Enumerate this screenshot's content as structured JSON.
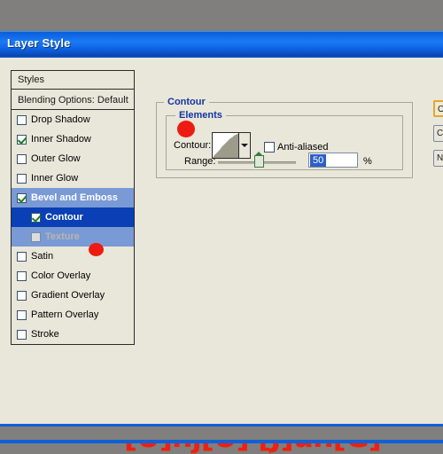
{
  "window": {
    "title": "Layer Style"
  },
  "styles_panel": {
    "header": "Styles",
    "blending_options": "Blending Options: Default",
    "effects": [
      {
        "label": "Drop Shadow",
        "checked": false,
        "sub": false,
        "state": "normal"
      },
      {
        "label": "Inner Shadow",
        "checked": true,
        "sub": false,
        "state": "normal"
      },
      {
        "label": "Outer Glow",
        "checked": false,
        "sub": false,
        "state": "normal"
      },
      {
        "label": "Inner Glow",
        "checked": false,
        "sub": false,
        "state": "normal"
      },
      {
        "label": "Bevel and Emboss",
        "checked": true,
        "sub": false,
        "state": "selected-light"
      },
      {
        "label": "Contour",
        "checked": true,
        "sub": true,
        "state": "selected-dark"
      },
      {
        "label": "Texture",
        "checked": false,
        "sub": true,
        "state": "disabled"
      },
      {
        "label": "Satin",
        "checked": false,
        "sub": false,
        "state": "normal"
      },
      {
        "label": "Color Overlay",
        "checked": false,
        "sub": false,
        "state": "normal"
      },
      {
        "label": "Gradient Overlay",
        "checked": false,
        "sub": false,
        "state": "normal"
      },
      {
        "label": "Pattern Overlay",
        "checked": false,
        "sub": false,
        "state": "normal"
      },
      {
        "label": "Stroke",
        "checked": false,
        "sub": false,
        "state": "normal"
      }
    ]
  },
  "contour_panel": {
    "group_legend": "Contour",
    "elements_legend": "Elements",
    "contour_label": "Contour:",
    "antialiased_label": "Anti-aliased",
    "antialiased_checked": false,
    "range_label": "Range:",
    "range_value": "50",
    "range_percent": "%",
    "range_slider_position": 50
  },
  "buttons": {
    "ok": "OK",
    "cancel": "Cancel",
    "new_style": "New Style..."
  },
  "watermark": {
    "text": "[U]nj[U] [J]un[G]"
  },
  "colors": {
    "titlebar_blue": "#1269e8",
    "dialog_face": "#e9e6da",
    "desktop_gray": "#807f7d",
    "selection_light": "#7a9ad6",
    "selection_dark": "#0a3fb5",
    "legend_blue": "#13369e",
    "annotation_red": "#ee1b12",
    "watermark_red": "#ef2010",
    "field_selection_blue": "#2e5fc8"
  }
}
